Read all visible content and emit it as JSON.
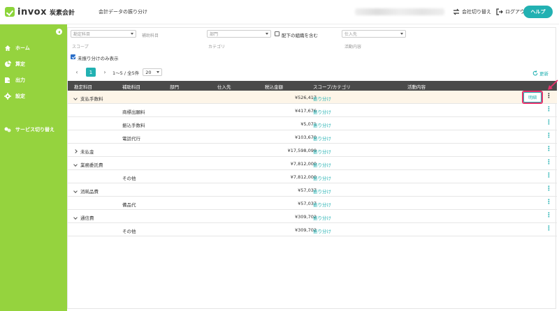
{
  "header": {
    "logo_text": "invox",
    "logo_sub": "炭素会計",
    "page_title": "会計データの振り分け",
    "switch_company": "会社切り替え",
    "logout": "ログアウト",
    "help": "ヘルプ"
  },
  "sidebar": {
    "items": [
      {
        "label": "ホーム",
        "icon": "home-icon"
      },
      {
        "label": "算定",
        "icon": "pie-chart-icon"
      },
      {
        "label": "出力",
        "icon": "export-icon"
      },
      {
        "label": "設定",
        "icon": "gear-icon"
      },
      {
        "label": "サービス切り替え",
        "icon": "switch-service-icon"
      }
    ]
  },
  "filters": {
    "account_placeholder": "勘定科目",
    "sub_account_label": "補助科目",
    "department_placeholder": "部門",
    "include_sub_orgs": "配下の組織を含む",
    "supplier_placeholder": "仕入先",
    "scope_label": "スコープ",
    "category_label": "カテゴリ",
    "activity_label": "活動内容",
    "unassigned_only": "未振り分けのみ表示"
  },
  "pager": {
    "current": "1",
    "range": "1〜5 / 全5件",
    "page_size": "20"
  },
  "refresh": "更新",
  "table": {
    "headers": {
      "account": "勘定科目",
      "sub": "補助科目",
      "dept": "部門",
      "supplier": "仕入先",
      "amount": "税込金額",
      "scope": "スコープ/カテゴリ",
      "activity": "活動内容"
    },
    "rows": [
      {
        "account": "支払手数料",
        "sub": "",
        "amount": "¥526,417",
        "scope": "振り分け"
      },
      {
        "account": "",
        "sub": "商標出願料",
        "amount": "¥417,676",
        "scope": "振り分け"
      },
      {
        "account": "",
        "sub": "振込手数料",
        "amount": "¥5,071",
        "scope": "振り分け"
      },
      {
        "account": "",
        "sub": "電話代行",
        "amount": "¥103,670",
        "scope": "振り分け"
      },
      {
        "account": "未払金",
        "sub": "",
        "amount": "¥17,598,099",
        "scope": "振り分け"
      },
      {
        "account": "業務委託費",
        "sub": "",
        "amount": "¥7,812,000",
        "scope": "振り分け"
      },
      {
        "account": "",
        "sub": "その他",
        "amount": "¥7,812,000",
        "scope": "振り分け"
      },
      {
        "account": "消耗品費",
        "sub": "",
        "amount": "¥57,037",
        "scope": "振り分け"
      },
      {
        "account": "",
        "sub": "備品代",
        "amount": "¥57,037",
        "scope": "振り分け"
      },
      {
        "account": "通信費",
        "sub": "",
        "amount": "¥309,702",
        "scope": "振り分け"
      },
      {
        "account": "",
        "sub": "その他",
        "amount": "¥309,702",
        "scope": "振り分け"
      }
    ],
    "detail_button": "明細"
  },
  "colors": {
    "brand_green": "#95d33e",
    "teal": "#22b1b2",
    "highlight_pink": "#e8326c"
  }
}
